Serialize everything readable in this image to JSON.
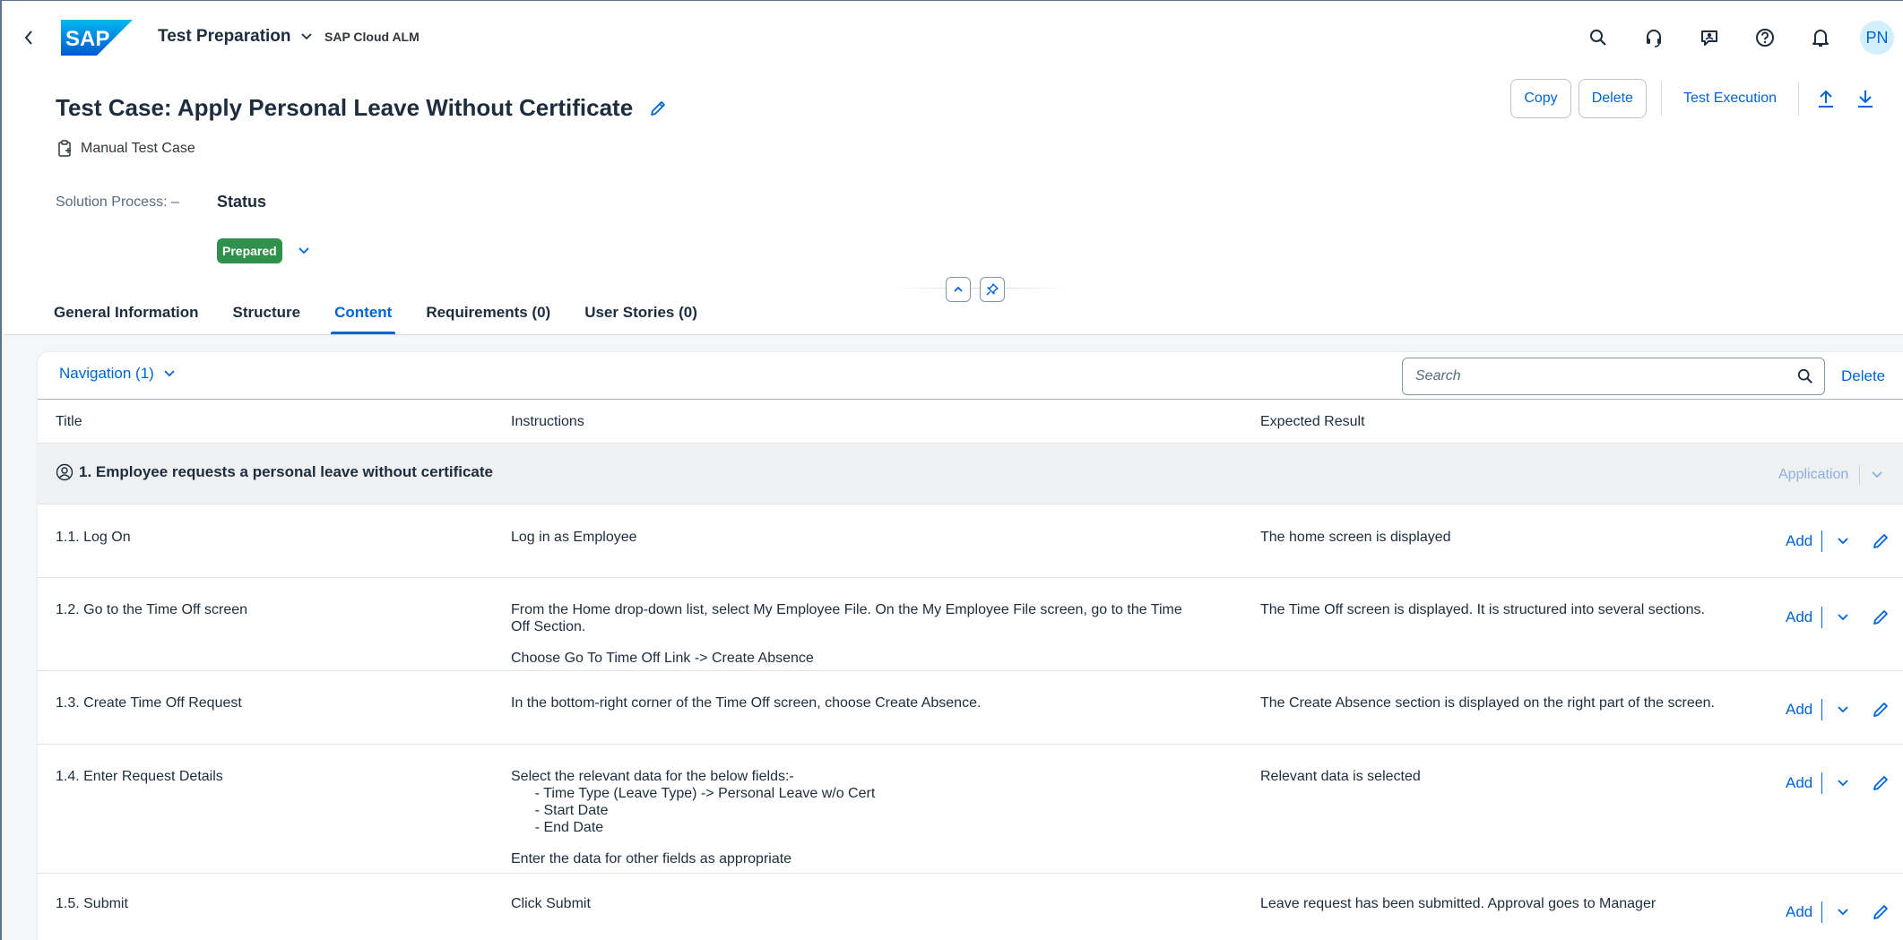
{
  "shell": {
    "logo_text": "SAP",
    "app_title": "Test Preparation",
    "app_subtitle": "SAP Cloud ALM",
    "avatar_initials": "PN"
  },
  "header": {
    "title": "Test Case: Apply Personal Leave Without Certificate",
    "subtitle": "Manual Test Case",
    "actions": {
      "copy": "Copy",
      "delete": "Delete",
      "test_execution": "Test Execution"
    },
    "solution_process": "Solution Process: –",
    "status_label": "Status",
    "status_value": "Prepared",
    "status_color": "#30914c"
  },
  "tabs": [
    {
      "label": "General Information",
      "active": false
    },
    {
      "label": "Structure",
      "active": false
    },
    {
      "label": "Content",
      "active": true
    },
    {
      "label": "Requirements (0)",
      "active": false
    },
    {
      "label": "User Stories (0)",
      "active": false
    }
  ],
  "content": {
    "navigation_label": "Navigation (1)",
    "search_placeholder": "Search",
    "delete_label": "Delete",
    "columns": {
      "title": "Title",
      "instructions": "Instructions",
      "expected": "Expected Result"
    },
    "group": {
      "title": "1. Employee requests a personal leave without certificate",
      "app_label": "Application"
    },
    "add_label": "Add",
    "rows": [
      {
        "title": "1.1. Log On",
        "instructions": "Log in as Employee",
        "instructions2": "",
        "expected": "The home screen is displayed"
      },
      {
        "title": "1.2. Go to the Time Off screen",
        "instructions": "From the Home drop-down list, select My Employee File. On the My Employee File screen, go to the Time\nOff Section.",
        "instructions2": "Choose Go To Time Off Link -> Create Absence",
        "expected": "The Time Off screen is displayed. It is structured into several sections."
      },
      {
        "title": "1.3. Create Time Off Request",
        "instructions": "In the bottom-right corner of the Time Off screen, choose Create Absence.",
        "instructions2": "",
        "expected": "The Create Absence section is displayed on the right part of the screen."
      },
      {
        "title": "1.4. Enter Request Details",
        "instructions": "Select the relevant data for the below fields:-\n      - Time Type (Leave Type) -> Personal Leave w/o Cert\n      - Start Date\n      - End Date",
        "instructions2": "Enter the data for other fields as appropriate",
        "expected": "Relevant data is selected"
      },
      {
        "title": "1.5. Submit",
        "instructions": "Click Submit",
        "instructions2": "",
        "expected": "Leave request has been submitted. Approval goes to Manager"
      }
    ]
  },
  "colors": {
    "accent": "#0064d9",
    "text": "#1d2d3e",
    "group_bg": "#eef0f2",
    "positive": "#30914c"
  }
}
